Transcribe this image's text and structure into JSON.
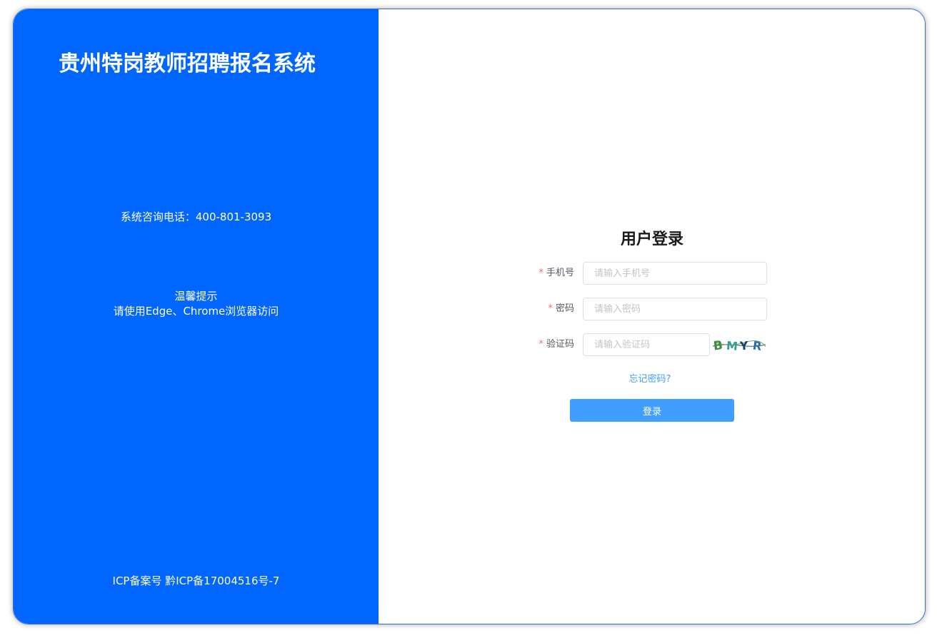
{
  "left_panel": {
    "title": "贵州特岗教师招聘报名系统",
    "hotline": "系统咨询电话：400-801-3093",
    "tips_heading": "温馨提示",
    "tips_text": "请使用Edge、Chrome浏览器访问",
    "icp": "ICP备案号 黔ICP备17004516号-7",
    "background_color": "#0066ff"
  },
  "login": {
    "title": "用户登录",
    "required_mark": "*",
    "phone": {
      "label": "手机号",
      "placeholder": "请输入手机号"
    },
    "password": {
      "label": "密码",
      "placeholder": "请输入密码"
    },
    "captcha": {
      "label": "验证码",
      "placeholder": "请输入验证码",
      "image_text": "BMYR"
    },
    "forgot_password": "忘记密码?",
    "submit_label": "登录",
    "accent_color": "#409eff"
  }
}
